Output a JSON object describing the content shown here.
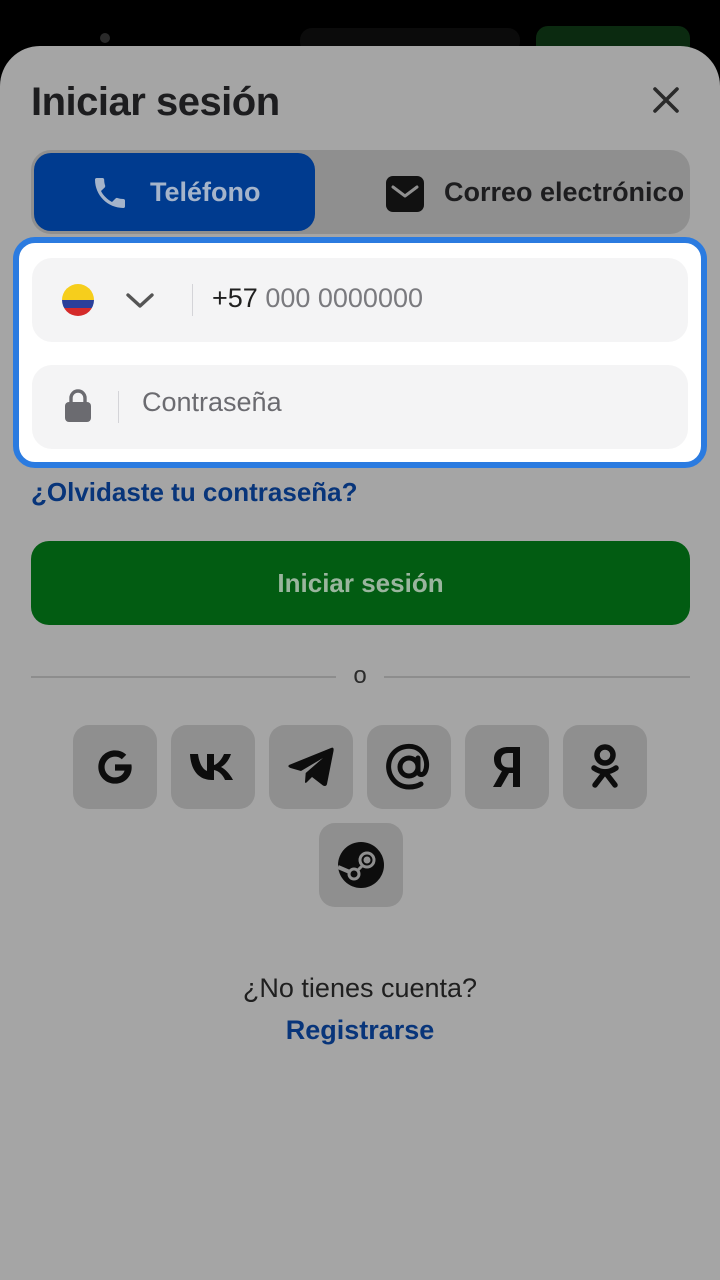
{
  "header": {
    "title": "Iniciar sesión"
  },
  "tabs": [
    {
      "label": "Teléfono",
      "icon": "phone-icon",
      "active": true
    },
    {
      "label": "Correo electrónico",
      "icon": "mail-icon",
      "active": false
    }
  ],
  "phone_field": {
    "country_flag": "colombia-flag-icon",
    "prefix": "+57",
    "placeholder": "000 0000000"
  },
  "password_field": {
    "placeholder": "Contraseña"
  },
  "forgot_password": "¿Olvidaste tu contraseña?",
  "login_button": "Iniciar sesión",
  "divider_text": "o",
  "social_logins": [
    "google-icon",
    "vk-icon",
    "telegram-icon",
    "mail-ru-icon",
    "yandex-icon",
    "odnoklassniki-icon",
    "steam-icon"
  ],
  "footer": {
    "no_account": "¿No tienes cuenta?",
    "register": "Registrarse"
  },
  "colors": {
    "overlay": "#a5a5a5",
    "active_tab": "#003b8f",
    "login_button": "#025c12",
    "focus_border": "#2b7be0",
    "link": "#08357a"
  }
}
